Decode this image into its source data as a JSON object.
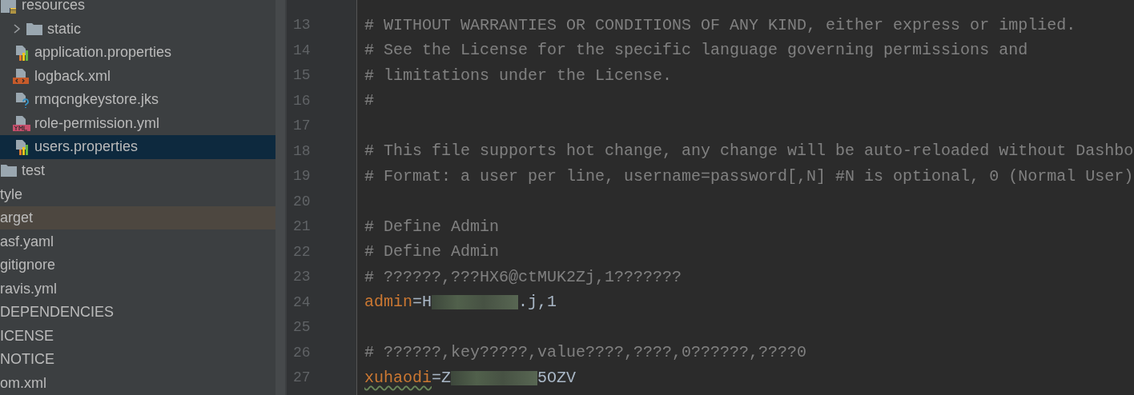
{
  "tree": [
    {
      "label": "resources",
      "kind": "resources",
      "selected": false,
      "excluded": false,
      "children": [
        {
          "label": "static",
          "kind": "folder",
          "expanded": false,
          "selected": false,
          "excluded": false
        },
        {
          "label": "application.properties",
          "kind": "properties",
          "selected": false,
          "excluded": false
        },
        {
          "label": "logback.xml",
          "kind": "xml",
          "selected": false,
          "excluded": false
        },
        {
          "label": "rmqcngkeystore.jks",
          "kind": "unknown",
          "selected": false,
          "excluded": false
        },
        {
          "label": "role-permission.yml",
          "kind": "yml",
          "selected": false,
          "excluded": false
        },
        {
          "label": "users.properties",
          "kind": "properties",
          "selected": true,
          "excluded": false
        }
      ]
    },
    {
      "label": "test",
      "kind": "cut-folder",
      "selected": false,
      "excluded": false
    },
    {
      "label": "tyle",
      "kind": "cut",
      "selected": false,
      "excluded": false
    },
    {
      "label": "arget",
      "kind": "cut",
      "selected": false,
      "excluded": true
    },
    {
      "label": "asf.yaml",
      "kind": "cut",
      "selected": false,
      "excluded": false
    },
    {
      "label": "gitignore",
      "kind": "cut",
      "selected": false,
      "excluded": false
    },
    {
      "label": "ravis.yml",
      "kind": "cut",
      "selected": false,
      "excluded": false
    },
    {
      "label": "DEPENDENCIES",
      "kind": "cut",
      "selected": false,
      "excluded": false
    },
    {
      "label": "ICENSE",
      "kind": "cut",
      "selected": false,
      "excluded": false
    },
    {
      "label": "NOTICE",
      "kind": "cut",
      "selected": false,
      "excluded": false
    },
    {
      "label": "om.xml",
      "kind": "cut",
      "selected": false,
      "excluded": false
    }
  ],
  "editor": {
    "lines": [
      {
        "number": "13",
        "segments": [
          {
            "kind": "comment",
            "text": "# WITHOUT WARRANTIES OR CONDITIONS OF ANY KIND, either express or implied."
          }
        ]
      },
      {
        "number": "14",
        "segments": [
          {
            "kind": "comment",
            "text": "# See the License for the specific language governing permissions and"
          }
        ]
      },
      {
        "number": "15",
        "segments": [
          {
            "kind": "comment",
            "text": "# limitations under the License."
          }
        ]
      },
      {
        "number": "16",
        "segments": [
          {
            "kind": "comment",
            "text": "#"
          }
        ]
      },
      {
        "number": "17"
      },
      {
        "number": "18",
        "segments": [
          {
            "kind": "comment",
            "text": "# This file supports hot change, any change will be auto-reloaded without Dashbo"
          }
        ]
      },
      {
        "number": "19",
        "segments": [
          {
            "kind": "comment",
            "text": "# Format: a user per line, username=password[,N] #N is optional, 0 (Normal User)"
          }
        ]
      },
      {
        "number": "20"
      },
      {
        "number": "21",
        "segments": [
          {
            "kind": "comment",
            "text": "# Define Admin"
          }
        ]
      },
      {
        "number": "22",
        "segments": [
          {
            "kind": "comment",
            "text": "# Define Admin"
          }
        ]
      },
      {
        "number": "23",
        "segments": [
          {
            "kind": "comment",
            "text": "# ??????,???HX6@ctMUK2Zj,1???????"
          }
        ]
      },
      {
        "number": "24",
        "segments": [
          {
            "kind": "key",
            "text": "admin"
          },
          {
            "kind": "value",
            "text": "=H"
          },
          {
            "kind": "redacted"
          },
          {
            "kind": "value",
            "text": ".j,1"
          }
        ]
      },
      {
        "number": "25"
      },
      {
        "number": "26",
        "segments": [
          {
            "kind": "comment",
            "text": "# ??????,key?????,value????,????,0??????,????0"
          }
        ]
      },
      {
        "number": "27",
        "segments": [
          {
            "kind": "typo-key",
            "text": "xuhaodi"
          },
          {
            "kind": "value",
            "text": "=Z"
          },
          {
            "kind": "redacted"
          },
          {
            "kind": "value",
            "text": "5OZV"
          }
        ]
      }
    ]
  }
}
